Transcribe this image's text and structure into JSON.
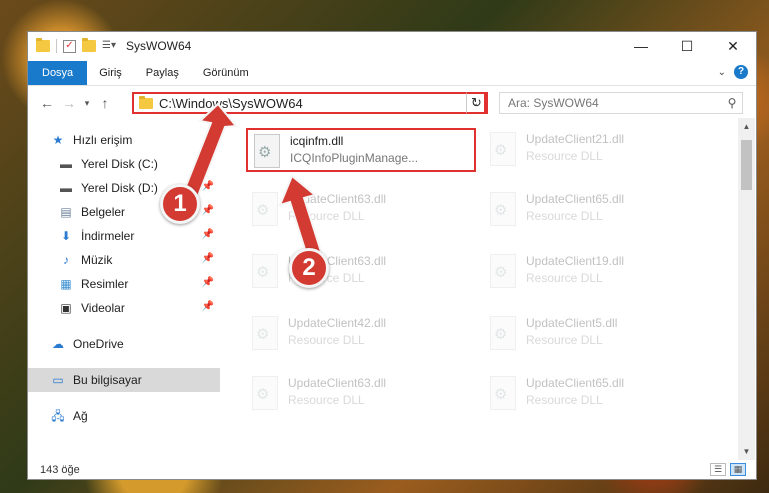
{
  "window": {
    "title": "SysWOW64",
    "controls": {
      "minimize": "—",
      "maximize": "☐",
      "close": "✕"
    }
  },
  "ribbon": {
    "tabs": [
      {
        "label": "Dosya",
        "active": true
      },
      {
        "label": "Giriş"
      },
      {
        "label": "Paylaş"
      },
      {
        "label": "Görünüm"
      }
    ]
  },
  "address": {
    "path": "C:\\Windows\\SysWOW64",
    "search_placeholder": "Ara: SysWOW64"
  },
  "sidebar": {
    "quick_access": "Hızlı erişim",
    "items": [
      {
        "label": "Yerel Disk (C:)",
        "icon": "drive-icon"
      },
      {
        "label": "Yerel Disk (D:)",
        "icon": "drive-icon"
      },
      {
        "label": "Belgeler",
        "icon": "document-icon"
      },
      {
        "label": "İndirmeler",
        "icon": "download-icon"
      },
      {
        "label": "Müzik",
        "icon": "music-icon"
      },
      {
        "label": "Resimler",
        "icon": "picture-icon"
      },
      {
        "label": "Videolar",
        "icon": "video-icon"
      }
    ],
    "onedrive": "OneDrive",
    "this_pc": "Bu bilgisayar",
    "network": "Ağ"
  },
  "files": [
    {
      "name": "icqinfm.dll",
      "type": "ICQInfoPluginManage...",
      "highlighted": true
    },
    {
      "name": "UpdateClient21.dll",
      "type": "Resource DLL"
    },
    {
      "name": "UpdateClient63.dll",
      "type": "Resource DLL"
    },
    {
      "name": "UpdateClient65.dll",
      "type": "Resource DLL"
    },
    {
      "name": "UpdateClient63.dll",
      "type": "Resource DLL"
    },
    {
      "name": "UpdateClient19.dll",
      "type": "Resource DLL"
    },
    {
      "name": "UpdateClient42.dll",
      "type": "Resource DLL"
    },
    {
      "name": "UpdateClient5.dll",
      "type": "Resource DLL"
    },
    {
      "name": "UpdateClient63.dll",
      "type": "Resource DLL"
    },
    {
      "name": "UpdateClient65.dll",
      "type": "Resource DLL"
    }
  ],
  "status": {
    "count": "143 öğe"
  },
  "annotations": {
    "step1": "1",
    "step2": "2",
    "color": "#d33a32"
  }
}
